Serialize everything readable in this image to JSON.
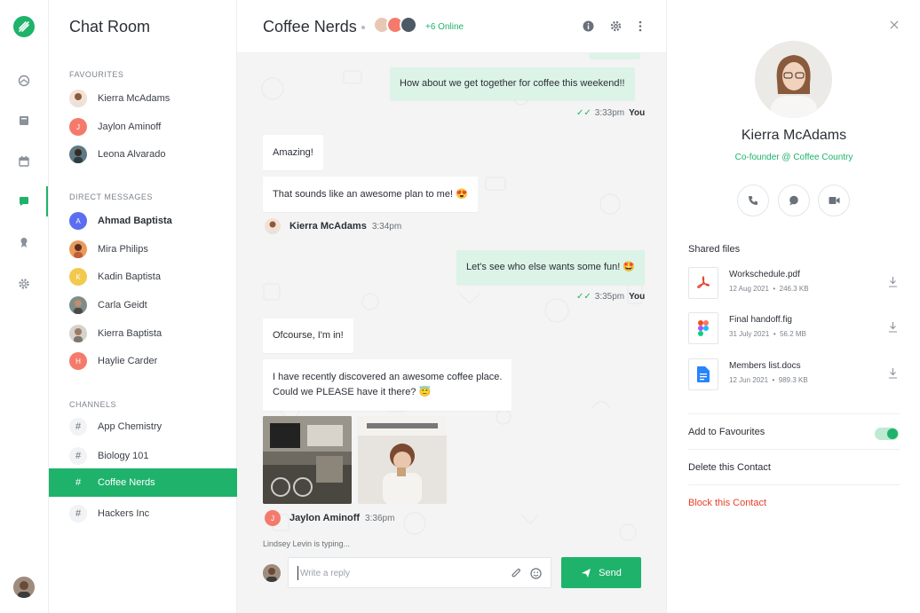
{
  "sidebar": {
    "title": "Chat Room",
    "favourites_label": "Favourites",
    "favourites": [
      {
        "name": "Kierra McAdams",
        "initial": ""
      },
      {
        "name": "Jaylon Aminoff",
        "initial": "J"
      },
      {
        "name": "Leona Alvarado",
        "initial": ""
      }
    ],
    "direct_label": "Direct Messages",
    "direct": [
      {
        "name": "Ahmad Baptista",
        "initial": "A"
      },
      {
        "name": "Mira Philips",
        "initial": ""
      },
      {
        "name": "Kadin Baptista",
        "initial": "K"
      },
      {
        "name": "Carla Geidt",
        "initial": ""
      },
      {
        "name": "Kierra Baptista",
        "initial": ""
      },
      {
        "name": "Haylie Carder",
        "initial": "H"
      }
    ],
    "channels_label": "Channels",
    "channels": [
      {
        "name": "App Chemistry",
        "symbol": "#"
      },
      {
        "name": "Biology 101",
        "symbol": "#"
      },
      {
        "name": "Coffee Nerds",
        "symbol": "#"
      },
      {
        "name": "Hackers Inc",
        "symbol": "#"
      }
    ]
  },
  "chat": {
    "title": "Coffee Nerds",
    "online": "+6 Online",
    "messages": [
      {
        "text": "How about we get together for coffee this weekend!!"
      },
      {
        "text": "Amazing!"
      },
      {
        "text": "That sounds like an awesome plan to me! 😍"
      },
      {
        "text": "Let's see who else wants some fun! 🤩"
      },
      {
        "text": "Ofcourse, I'm in!"
      },
      {
        "text": "I have recently discovered an awesome coffee place."
      },
      {
        "text": "Could we PLEASE have it there? 😇"
      }
    ],
    "meta": [
      {
        "check": "✓✓",
        "time": "3:33pm",
        "who": "You"
      },
      {
        "name": "Kierra McAdams",
        "time": "3:34pm"
      },
      {
        "check": "✓✓",
        "time": "3:35pm",
        "who": "You"
      },
      {
        "name": "Jaylon Aminoff",
        "time": "3:36pm",
        "initial": "J"
      }
    ],
    "typing": "Lindsey Levin is typing...",
    "composer_placeholder": "Write a reply",
    "send_label": "Send"
  },
  "profile": {
    "name": "Kierra McAdams",
    "role": "Co-founder @ Coffee Country",
    "shared_files_label": "Shared files",
    "files": [
      {
        "name": "Workschedule.pdf",
        "date": "12 Aug 2021",
        "size": "246.3 KB",
        "icon": "pdf-icon"
      },
      {
        "name": "Final handoff.fig",
        "date": "31 July 2021",
        "size": "56.2 MB",
        "icon": "figma-icon"
      },
      {
        "name": "Members list.docs",
        "date": "12 Jun 2021",
        "size": "989.3 KB",
        "icon": "doc-icon"
      }
    ],
    "add_favourites": "Add to Favourites",
    "favourite_on": true,
    "delete_contact": "Delete this Contact",
    "block_contact": "Block this Contact"
  },
  "colors": {
    "accent": "#1fb26b",
    "danger": "#e53f2b",
    "out_bubble": "#dcf3e7"
  }
}
